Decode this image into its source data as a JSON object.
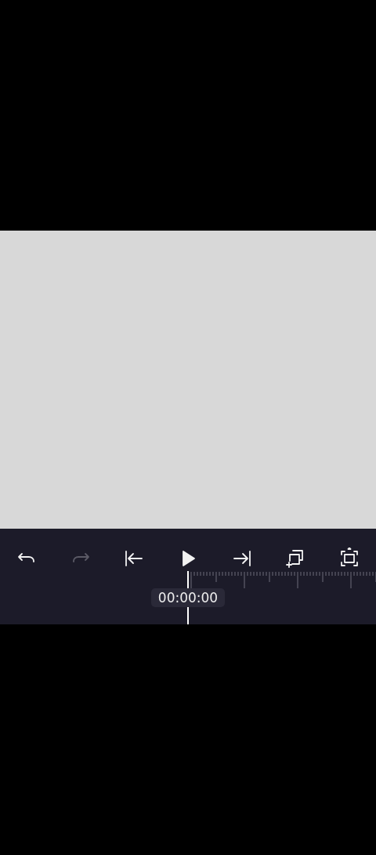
{
  "preview": {
    "kind": "blank"
  },
  "toolbar": {
    "buttons": [
      {
        "kind": "undo",
        "disabled": false
      },
      {
        "kind": "redo",
        "disabled": true
      },
      {
        "kind": "to-start",
        "disabled": false
      },
      {
        "kind": "play",
        "disabled": false
      },
      {
        "kind": "to-end",
        "disabled": false
      },
      {
        "kind": "add-layer",
        "disabled": false
      },
      {
        "kind": "fullscreen",
        "disabled": false
      }
    ]
  },
  "timeline": {
    "timecode": "00:00:00"
  }
}
